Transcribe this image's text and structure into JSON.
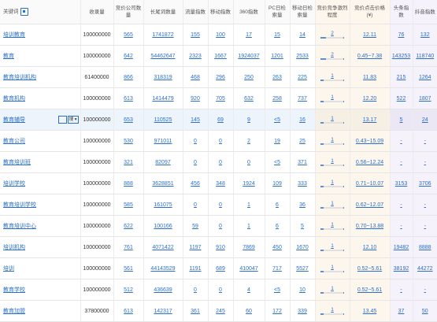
{
  "headers": {
    "keyword": "关键词",
    "index": "收录量",
    "bid_count": "竞价公司数量",
    "long_tail": "长尾词数量",
    "traffic": "流量指数",
    "mobile": "移动指数",
    "s360": "360指数",
    "pc_daily": "PC日检索量",
    "mobile_daily": "移动日检索量",
    "competition": "竞价竞争激烈程度",
    "price": "竞价点击价格(¥)",
    "toutiao": "头条指数",
    "douyin": "抖音指数"
  },
  "row_controls": {
    "select_value": "搜"
  },
  "rows": [
    {
      "keyword": "培训教育",
      "index": "100000000",
      "bid_count": "565",
      "long_tail": "1741872",
      "traffic": "155",
      "mobile": "100",
      "s360": "17",
      "pc_daily": "15",
      "mobile_daily": "14",
      "competition": "2",
      "competition_level": 0.2,
      "price": "12.11",
      "toutiao": "76",
      "douyin": "132"
    },
    {
      "keyword": "教育",
      "index": "100000000",
      "bid_count": "642",
      "long_tail": "54462647",
      "traffic": "2323",
      "mobile": "1667",
      "s360": "1924037",
      "pc_daily": "1201",
      "mobile_daily": "2533",
      "competition": "2",
      "competition_level": 0.2,
      "price": "0.45~7.38",
      "toutiao": "143253",
      "douyin": "118740"
    },
    {
      "keyword": "教育培训机构",
      "index": "61400000",
      "bid_count": "866",
      "long_tail": "318319",
      "traffic": "468",
      "mobile": "296",
      "s360": "250",
      "pc_daily": "263",
      "mobile_daily": "225",
      "competition": "1",
      "competition_level": 0.1,
      "price": "11.83",
      "toutiao": "215",
      "douyin": "1264"
    },
    {
      "keyword": "教育机构",
      "index": "100000000",
      "bid_count": "613",
      "long_tail": "1414479",
      "traffic": "920",
      "mobile": "705",
      "s360": "632",
      "pc_daily": "258",
      "mobile_daily": "737",
      "competition": "1",
      "competition_level": 0.1,
      "price": "12.20",
      "toutiao": "522",
      "douyin": "1807"
    },
    {
      "keyword": "教育辅导",
      "index": "100000000",
      "bid_count": "653",
      "long_tail": "110525",
      "traffic": "145",
      "mobile": "69",
      "s360": "9",
      "pc_daily": "<5",
      "mobile_daily": "16",
      "competition": "1",
      "competition_level": 0.1,
      "price": "13.17",
      "toutiao": "5",
      "douyin": "24"
    },
    {
      "keyword": "教育公司",
      "index": "100000000",
      "bid_count": "530",
      "long_tail": "971011",
      "traffic": "0",
      "mobile": "0",
      "s360": "2",
      "pc_daily": "19",
      "mobile_daily": "25",
      "competition": "1",
      "competition_level": 0.1,
      "price": "0.43~15.09",
      "toutiao": "-",
      "douyin": "-"
    },
    {
      "keyword": "教育培训班",
      "index": "100000000",
      "bid_count": "321",
      "long_tail": "82097",
      "traffic": "0",
      "mobile": "0",
      "s360": "0",
      "pc_daily": "<5",
      "mobile_daily": "371",
      "competition": "1",
      "competition_level": 0.1,
      "price": "0.56~12.24",
      "toutiao": "-",
      "douyin": "-"
    },
    {
      "keyword": "培训学校",
      "index": "100000000",
      "bid_count": "888",
      "long_tail": "3628851",
      "traffic": "456",
      "mobile": "348",
      "s360": "1924",
      "pc_daily": "109",
      "mobile_daily": "333",
      "competition": "1",
      "competition_level": 0.1,
      "price": "0.71~10.07",
      "toutiao": "3153",
      "douyin": "3706"
    },
    {
      "keyword": "教育培训学校",
      "index": "100000000",
      "bid_count": "585",
      "long_tail": "161075",
      "traffic": "0",
      "mobile": "0",
      "s360": "1",
      "pc_daily": "6",
      "mobile_daily": "36",
      "competition": "1",
      "competition_level": 0.1,
      "price": "0.62~12.07",
      "toutiao": "-",
      "douyin": "-"
    },
    {
      "keyword": "教育培训中心",
      "index": "100000000",
      "bid_count": "622",
      "long_tail": "100166",
      "traffic": "59",
      "mobile": "0",
      "s360": "1",
      "pc_daily": "6",
      "mobile_daily": "5",
      "competition": "1",
      "competition_level": 0.1,
      "price": "0.70~13.88",
      "toutiao": "-",
      "douyin": "-"
    },
    {
      "keyword": "培训机构",
      "index": "100000000",
      "bid_count": "761",
      "long_tail": "4071422",
      "traffic": "1197",
      "mobile": "910",
      "s360": "7869",
      "pc_daily": "450",
      "mobile_daily": "1670",
      "competition": "1",
      "competition_level": 0.1,
      "price": "12.10",
      "toutiao": "19482",
      "douyin": "8888"
    },
    {
      "keyword": "培训",
      "index": "100000000",
      "bid_count": "561",
      "long_tail": "44143529",
      "traffic": "1191",
      "mobile": "689",
      "s360": "410047",
      "pc_daily": "717",
      "mobile_daily": "5527",
      "competition": "1",
      "competition_level": 0.1,
      "price": "0.52~5.61",
      "toutiao": "38192",
      "douyin": "44272"
    },
    {
      "keyword": "教育学校",
      "index": "100000000",
      "bid_count": "512",
      "long_tail": "436639",
      "traffic": "0",
      "mobile": "0",
      "s360": "4",
      "pc_daily": "<5",
      "mobile_daily": "10",
      "competition": "1",
      "competition_level": 0.1,
      "price": "0.52~5.61",
      "toutiao": "-",
      "douyin": "-"
    },
    {
      "keyword": "教育加盟",
      "index": "37800000",
      "bid_count": "613",
      "long_tail": "142317",
      "traffic": "361",
      "mobile": "245",
      "s360": "60",
      "pc_daily": "172",
      "mobile_daily": "339",
      "competition": "1",
      "competition_level": 0.1,
      "price": "13.45",
      "toutiao": "37",
      "douyin": "50"
    }
  ]
}
